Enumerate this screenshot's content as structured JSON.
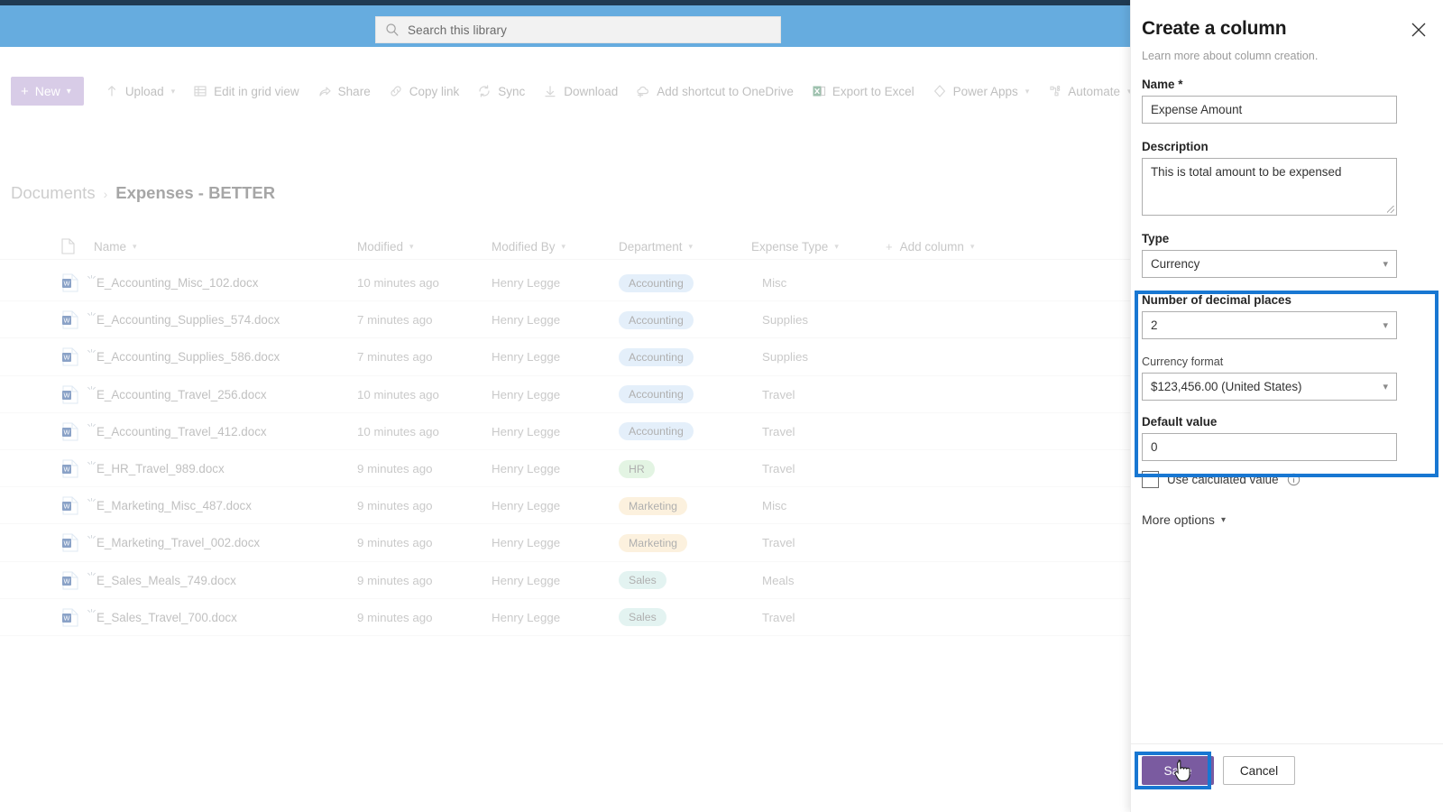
{
  "suite": {
    "search": {
      "placeholder": "Search this library",
      "icon": "search-icon"
    }
  },
  "colors": {
    "suitebar": "#66acdf",
    "topstrip": "#1f3a52",
    "highlight": "#1877d2",
    "primary_button": "#7a5ba0",
    "new_button": "#b9a3d4",
    "pill_accounting": "#cfe3f7",
    "pill_hr": "#cdeccd",
    "pill_marketing": "#fae7c4",
    "pill_sales": "#cdeae6"
  },
  "command_bar": {
    "new_label": "New",
    "items": [
      {
        "label": "Upload",
        "icon": "upload-icon",
        "has_chevron": true
      },
      {
        "label": "Edit in grid view",
        "icon": "grid-icon",
        "has_chevron": false
      },
      {
        "label": "Share",
        "icon": "share-icon",
        "has_chevron": false
      },
      {
        "label": "Copy link",
        "icon": "link-icon",
        "has_chevron": false
      },
      {
        "label": "Sync",
        "icon": "sync-icon",
        "has_chevron": false
      },
      {
        "label": "Download",
        "icon": "download-icon",
        "has_chevron": false
      },
      {
        "label": "Add shortcut to OneDrive",
        "icon": "onedrive-shortcut-icon",
        "has_chevron": false
      },
      {
        "label": "Export to Excel",
        "icon": "excel-icon",
        "has_chevron": false
      },
      {
        "label": "Power Apps",
        "icon": "power-apps-icon",
        "has_chevron": true
      },
      {
        "label": "Automate",
        "icon": "automate-icon",
        "has_chevron": true
      }
    ]
  },
  "breadcrumb": {
    "root": "Documents",
    "separator": "›",
    "current": "Expenses - BETTER"
  },
  "list": {
    "columns": [
      {
        "label": "Name",
        "has_chevron": true
      },
      {
        "label": "Modified",
        "has_chevron": true
      },
      {
        "label": "Modified By",
        "has_chevron": true
      },
      {
        "label": "Department",
        "has_chevron": true
      },
      {
        "label": "Expense Type",
        "has_chevron": true
      },
      {
        "label": "Add column",
        "has_chevron": true,
        "is_add": true
      }
    ],
    "rows": [
      {
        "name": "E_Accounting_Misc_102.docx",
        "modified": "10 minutes ago",
        "modified_by": "Henry Legge",
        "department": "Accounting",
        "dept_class": "acct",
        "expense_type": "Misc"
      },
      {
        "name": "E_Accounting_Supplies_574.docx",
        "modified": "7 minutes ago",
        "modified_by": "Henry Legge",
        "department": "Accounting",
        "dept_class": "acct",
        "expense_type": "Supplies"
      },
      {
        "name": "E_Accounting_Supplies_586.docx",
        "modified": "7 minutes ago",
        "modified_by": "Henry Legge",
        "department": "Accounting",
        "dept_class": "acct",
        "expense_type": "Supplies"
      },
      {
        "name": "E_Accounting_Travel_256.docx",
        "modified": "10 minutes ago",
        "modified_by": "Henry Legge",
        "department": "Accounting",
        "dept_class": "acct",
        "expense_type": "Travel"
      },
      {
        "name": "E_Accounting_Travel_412.docx",
        "modified": "10 minutes ago",
        "modified_by": "Henry Legge",
        "department": "Accounting",
        "dept_class": "acct",
        "expense_type": "Travel"
      },
      {
        "name": "E_HR_Travel_989.docx",
        "modified": "9 minutes ago",
        "modified_by": "Henry Legge",
        "department": "HR",
        "dept_class": "hr",
        "expense_type": "Travel"
      },
      {
        "name": "E_Marketing_Misc_487.docx",
        "modified": "9 minutes ago",
        "modified_by": "Henry Legge",
        "department": "Marketing",
        "dept_class": "mkt",
        "expense_type": "Misc"
      },
      {
        "name": "E_Marketing_Travel_002.docx",
        "modified": "9 minutes ago",
        "modified_by": "Henry Legge",
        "department": "Marketing",
        "dept_class": "mkt",
        "expense_type": "Travel"
      },
      {
        "name": "E_Sales_Meals_749.docx",
        "modified": "9 minutes ago",
        "modified_by": "Henry Legge",
        "department": "Sales",
        "dept_class": "sales",
        "expense_type": "Meals"
      },
      {
        "name": "E_Sales_Travel_700.docx",
        "modified": "9 minutes ago",
        "modified_by": "Henry Legge",
        "department": "Sales",
        "dept_class": "sales",
        "expense_type": "Travel"
      }
    ]
  },
  "panel": {
    "title": "Create a column",
    "subtitle": "Learn more about column creation.",
    "close_icon": "close-icon",
    "fields": {
      "name_label": "Name *",
      "name_value": "Expense Amount",
      "description_label": "Description",
      "description_value": "This is total amount to be expensed",
      "type_label": "Type",
      "type_value": "Currency",
      "decimals_label": "Number of decimal places",
      "decimals_value": "2",
      "currency_format_label": "Currency format",
      "currency_format_value": "$123,456.00 (United States)",
      "default_value_label": "Default value",
      "default_value_value": "0"
    },
    "calculated_checkbox_label": "Use calculated value",
    "calculated_info_icon": "info-icon",
    "more_options_label": "More options",
    "save_label": "Save",
    "cancel_label": "Cancel"
  }
}
